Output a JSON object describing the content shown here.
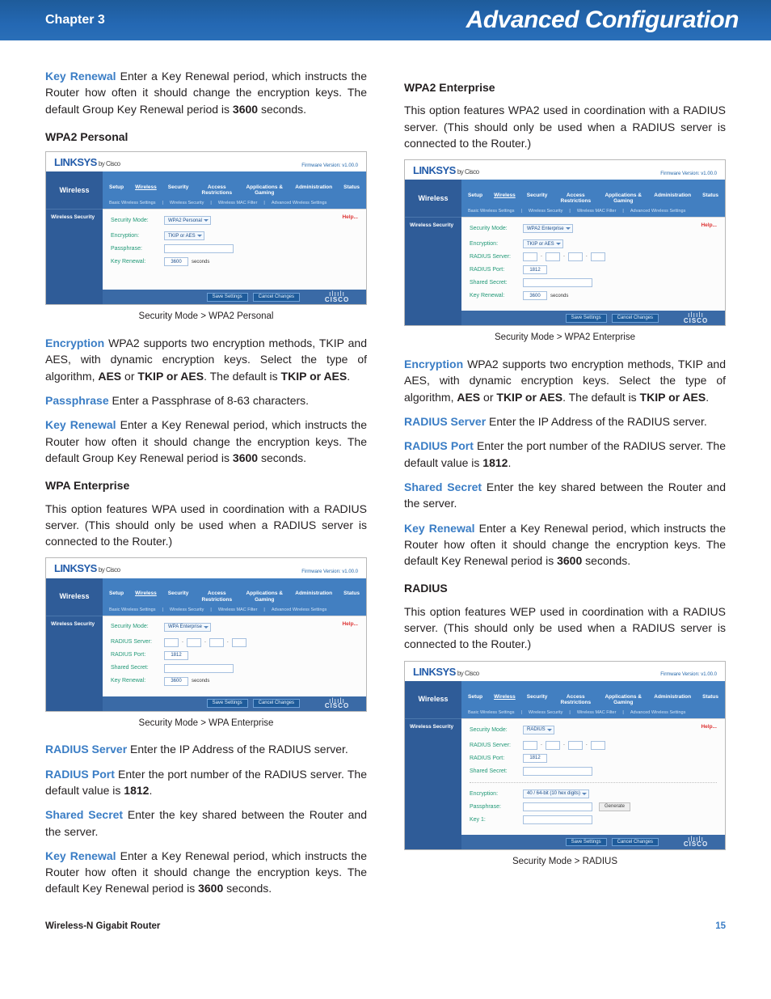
{
  "header": {
    "chapter": "Chapter 3",
    "title": "Advanced Configuration"
  },
  "footer": {
    "product": "Wireless-N Gigabit Router",
    "page": "15"
  },
  "left": {
    "p1_term": "Key Renewal",
    "p1_body": "  Enter a Key Renewal period, which instructs the Router how often it should change the encryption keys. The default Group Key Renewal period is ",
    "p1_bold": "3600",
    "p1_tail": " seconds.",
    "h1": "WPA2 Personal",
    "cap1": "Security Mode > WPA2 Personal",
    "p2a_term": "Encryption",
    "p2a_body": "  WPA2 supports two encryption methods, TKIP and AES, with dynamic encryption keys. Select the type of algorithm, ",
    "p2a_b1": "AES",
    "p2a_mid": " or ",
    "p2a_b2": "TKIP or AES",
    "p2a_mid2": ". The default is ",
    "p2a_b3": "TKIP or AES",
    "p2a_tail": ".",
    "p2b_term": "Passphrase",
    "p2b_body": "  Enter a Passphrase of 8-63 characters.",
    "p2c_term": "Key Renewal",
    "p2c_body": "  Enter a Key Renewal period, which instructs the Router how often it should change the encryption keys. The default Group Key Renewal period is ",
    "p2c_bold": "3600",
    "p2c_tail": " seconds.",
    "h2": "WPA Enterprise",
    "p3": "This option features WPA used in coordination with a RADIUS server. (This should only be used when a RADIUS server is connected to the Router.)",
    "cap2": "Security Mode > WPA Enterprise",
    "p4a_term": "RADIUS Server",
    "p4a_body": "  Enter the IP Address of the RADIUS server.",
    "p4b_term": "RADIUS Port",
    "p4b_body": "  Enter the port number of the RADIUS server. The default value is ",
    "p4b_bold": "1812",
    "p4b_tail": ".",
    "p4c_term": "Shared Secret",
    "p4c_body": "  Enter the key shared between the Router and the server.",
    "p4d_term": "Key Renewal",
    "p4d_body": "  Enter a Key Renewal period, which instructs the Router how often it should change the encryption keys. The default Key Renewal period is ",
    "p4d_bold": "3600",
    "p4d_tail": " seconds."
  },
  "right": {
    "h1": "WPA2 Enterprise",
    "p1": "This option features WPA2 used in coordination with a RADIUS server. (This should only be used when a RADIUS server is connected to the Router.)",
    "cap1": "Security Mode > WPA2 Enterprise",
    "p2a_term": "Encryption",
    "p2a_body": "  WPA2 supports two encryption methods, TKIP and AES, with dynamic encryption keys. Select the type of algorithm, ",
    "p2a_b1": "AES",
    "p2a_mid": " or ",
    "p2a_b2": "TKIP or AES",
    "p2a_mid2": ". The default is ",
    "p2a_b3": "TKIP or AES",
    "p2a_tail": ".",
    "p2b_term": "RADIUS Server",
    "p2b_body": "  Enter the IP Address of the RADIUS server.",
    "p2c_term": "RADIUS Port",
    "p2c_body": "  Enter the port number of the RADIUS server. The default value is ",
    "p2c_bold": "1812",
    "p2c_tail": ".",
    "p2d_term": "Shared Secret",
    "p2d_body": "  Enter the key shared between the Router and the server.",
    "p2e_term": "Key Renewal",
    "p2e_body": "  Enter a Key Renewal period, which instructs the Router how often it should change the encryption keys. The default Key Renewal period is ",
    "p2e_bold": "3600",
    "p2e_tail": " seconds.",
    "h2": "RADIUS",
    "p3": "This option features WEP used in coordination with a RADIUS server. (This should only be used when a RADIUS server is connected to the Router.)",
    "cap2": "Security Mode > RADIUS"
  },
  "fig_common": {
    "logo": "LINKSYS",
    "by": "by Cisco",
    "fw": "Firmware Version: v1.00.0",
    "section": "Wireless",
    "tabs": [
      "Setup",
      "Wireless",
      "Security",
      "Access Restrictions",
      "Applications & Gaming",
      "Administration",
      "Status"
    ],
    "subtabs": [
      "Basic Wireless Settings",
      "Wireless Security",
      "Wireless MAC Filter",
      "Advanced Wireless Settings"
    ],
    "side": "Wireless Security",
    "help": "Help...",
    "save": "Save Settings",
    "cancel": "Cancel Changes",
    "cisco_bars": "ılıılı",
    "cisco": "CISCO",
    "lbl_mode": "Security Mode:",
    "lbl_enc": "Encryption:",
    "lbl_pass": "Passphrase:",
    "lbl_renew": "Key Renewal:",
    "lbl_rserver": "RADIUS Server:",
    "lbl_rport": "RADIUS Port:",
    "lbl_secret": "Shared Secret:",
    "lbl_key1": "Key 1:",
    "unit_sec": "seconds",
    "btn_generate": "Generate"
  },
  "fig1": {
    "mode": "WPA2 Personal",
    "enc": "TKIP or AES",
    "renew": "3600"
  },
  "fig2": {
    "mode": "WPA Enterprise",
    "port": "1812",
    "renew": "3600"
  },
  "fig3": {
    "mode": "WPA2 Enterprise",
    "enc": "TKIP or AES",
    "port": "1812",
    "renew": "3600"
  },
  "fig4": {
    "mode": "RADIUS",
    "port": "1812",
    "enc_sel": "40 / 64-bit (10 hex digits)"
  }
}
